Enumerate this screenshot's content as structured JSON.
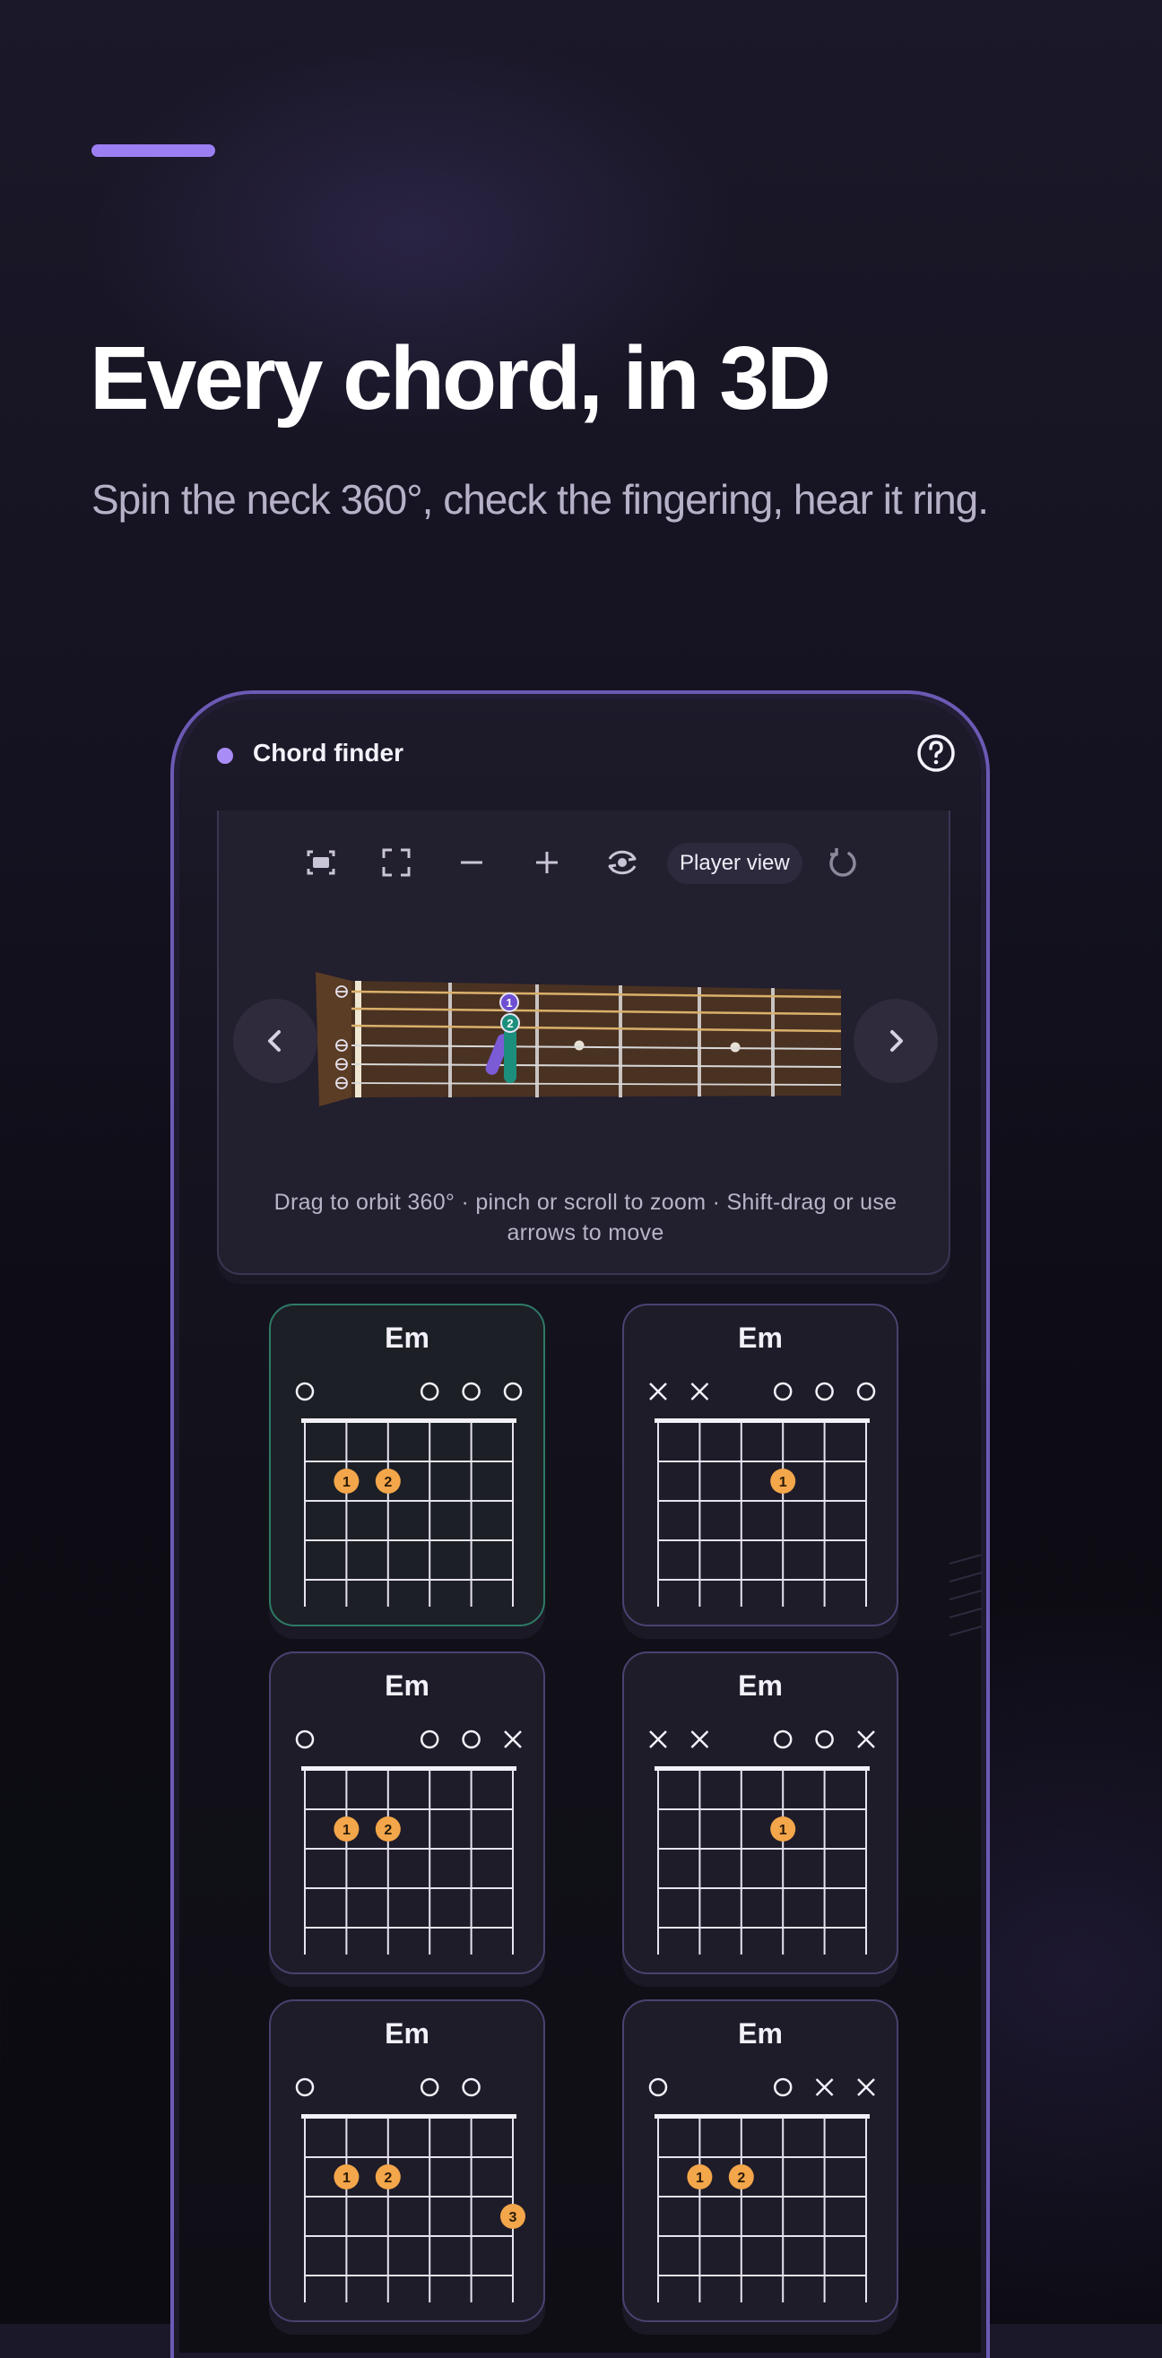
{
  "hero": {
    "title": "Every chord, in 3D",
    "subtitle": "Spin the neck 360°, check the fingering, hear it ring."
  },
  "app": {
    "title": "Chord finder",
    "help_icon": "help-circle-icon"
  },
  "toolbar": {
    "tools": [
      {
        "name": "fit-view-icon"
      },
      {
        "name": "fullscreen-icon"
      },
      {
        "name": "zoom-out-icon"
      },
      {
        "name": "zoom-in-icon"
      },
      {
        "name": "orbit-icon"
      }
    ],
    "player_view_label": "Player view",
    "reset_icon": "reset-icon"
  },
  "viewer": {
    "hint": "Drag to orbit 360° · pinch or scroll to zoom · Shift-drag or use arrows to move",
    "prev_icon": "chevron-left-icon",
    "next_icon": "chevron-right-icon",
    "finger_labels": [
      "1",
      "2"
    ]
  },
  "colors": {
    "accent": "#9b7ff2",
    "phone_border": "#6c5ab5",
    "finger_dot": "#f3a64a",
    "selected_card": "#2e7a66"
  },
  "voicings": [
    {
      "name": "Em",
      "selected": true,
      "top": [
        "o",
        "",
        "",
        "o",
        "o",
        "o"
      ],
      "dots": [
        {
          "s": 2,
          "f": 2,
          "l": "1"
        },
        {
          "s": 3,
          "f": 2,
          "l": "2"
        }
      ]
    },
    {
      "name": "Em",
      "selected": false,
      "top": [
        "x",
        "x",
        "",
        "o",
        "o",
        "o"
      ],
      "dots": [
        {
          "s": 4,
          "f": 2,
          "l": "1"
        }
      ]
    },
    {
      "name": "Em",
      "selected": false,
      "top": [
        "o",
        "",
        "",
        "o",
        "o",
        "x"
      ],
      "dots": [
        {
          "s": 2,
          "f": 2,
          "l": "1"
        },
        {
          "s": 3,
          "f": 2,
          "l": "2"
        }
      ]
    },
    {
      "name": "Em",
      "selected": false,
      "top": [
        "x",
        "x",
        "",
        "o",
        "o",
        "x"
      ],
      "dots": [
        {
          "s": 4,
          "f": 2,
          "l": "1"
        }
      ]
    },
    {
      "name": "Em",
      "selected": false,
      "top": [
        "o",
        "",
        "",
        "o",
        "o",
        ""
      ],
      "dots": [
        {
          "s": 2,
          "f": 2,
          "l": "1"
        },
        {
          "s": 3,
          "f": 2,
          "l": "2"
        },
        {
          "s": 6,
          "f": 3,
          "l": "3"
        }
      ]
    },
    {
      "name": "Em",
      "selected": false,
      "top": [
        "o",
        "",
        "",
        "o",
        "x",
        "x"
      ],
      "dots": [
        {
          "s": 2,
          "f": 2,
          "l": "1"
        },
        {
          "s": 3,
          "f": 2,
          "l": "2"
        }
      ]
    }
  ]
}
